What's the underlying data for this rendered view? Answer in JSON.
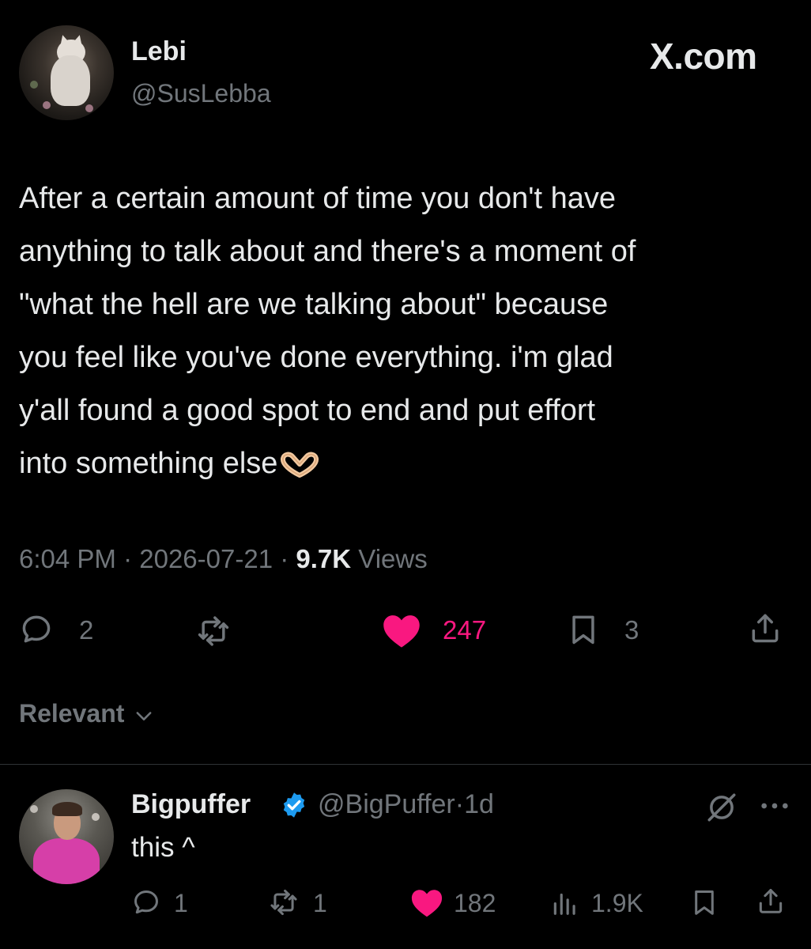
{
  "site_label": "X.com",
  "tweet": {
    "author_name": "Lebi",
    "author_handle": "@SusLebba",
    "text": "After a certain amount of time you don't have\nanything to talk about and there's a moment of\n\"what the hell are we talking about\" because\nyou feel like you've done everything. i'm glad\ny'all found a good spot to end and put effort\ninto something else",
    "emoji_icon": "heart-hands-icon",
    "time": "6:04 PM",
    "date": "2026-07-21",
    "views_count": "9.7K",
    "views_label": "Views",
    "separator": "·",
    "stats": {
      "replies": "2",
      "likes": "247",
      "bookmarks": "3"
    }
  },
  "sort": {
    "label": "Relevant"
  },
  "reply": {
    "author_name": "Bigpuffer",
    "author_handle": "@BigPuffer",
    "age": "1d",
    "text": "this ^",
    "stats": {
      "replies": "1",
      "retweets": "1",
      "likes": "182",
      "views": "1.9K"
    }
  },
  "colors": {
    "background": "#000000",
    "text": "#e7e9ea",
    "muted": "#71767b",
    "like": "#f91880",
    "verified": "#1d9bf0",
    "divider": "#2f3336"
  }
}
